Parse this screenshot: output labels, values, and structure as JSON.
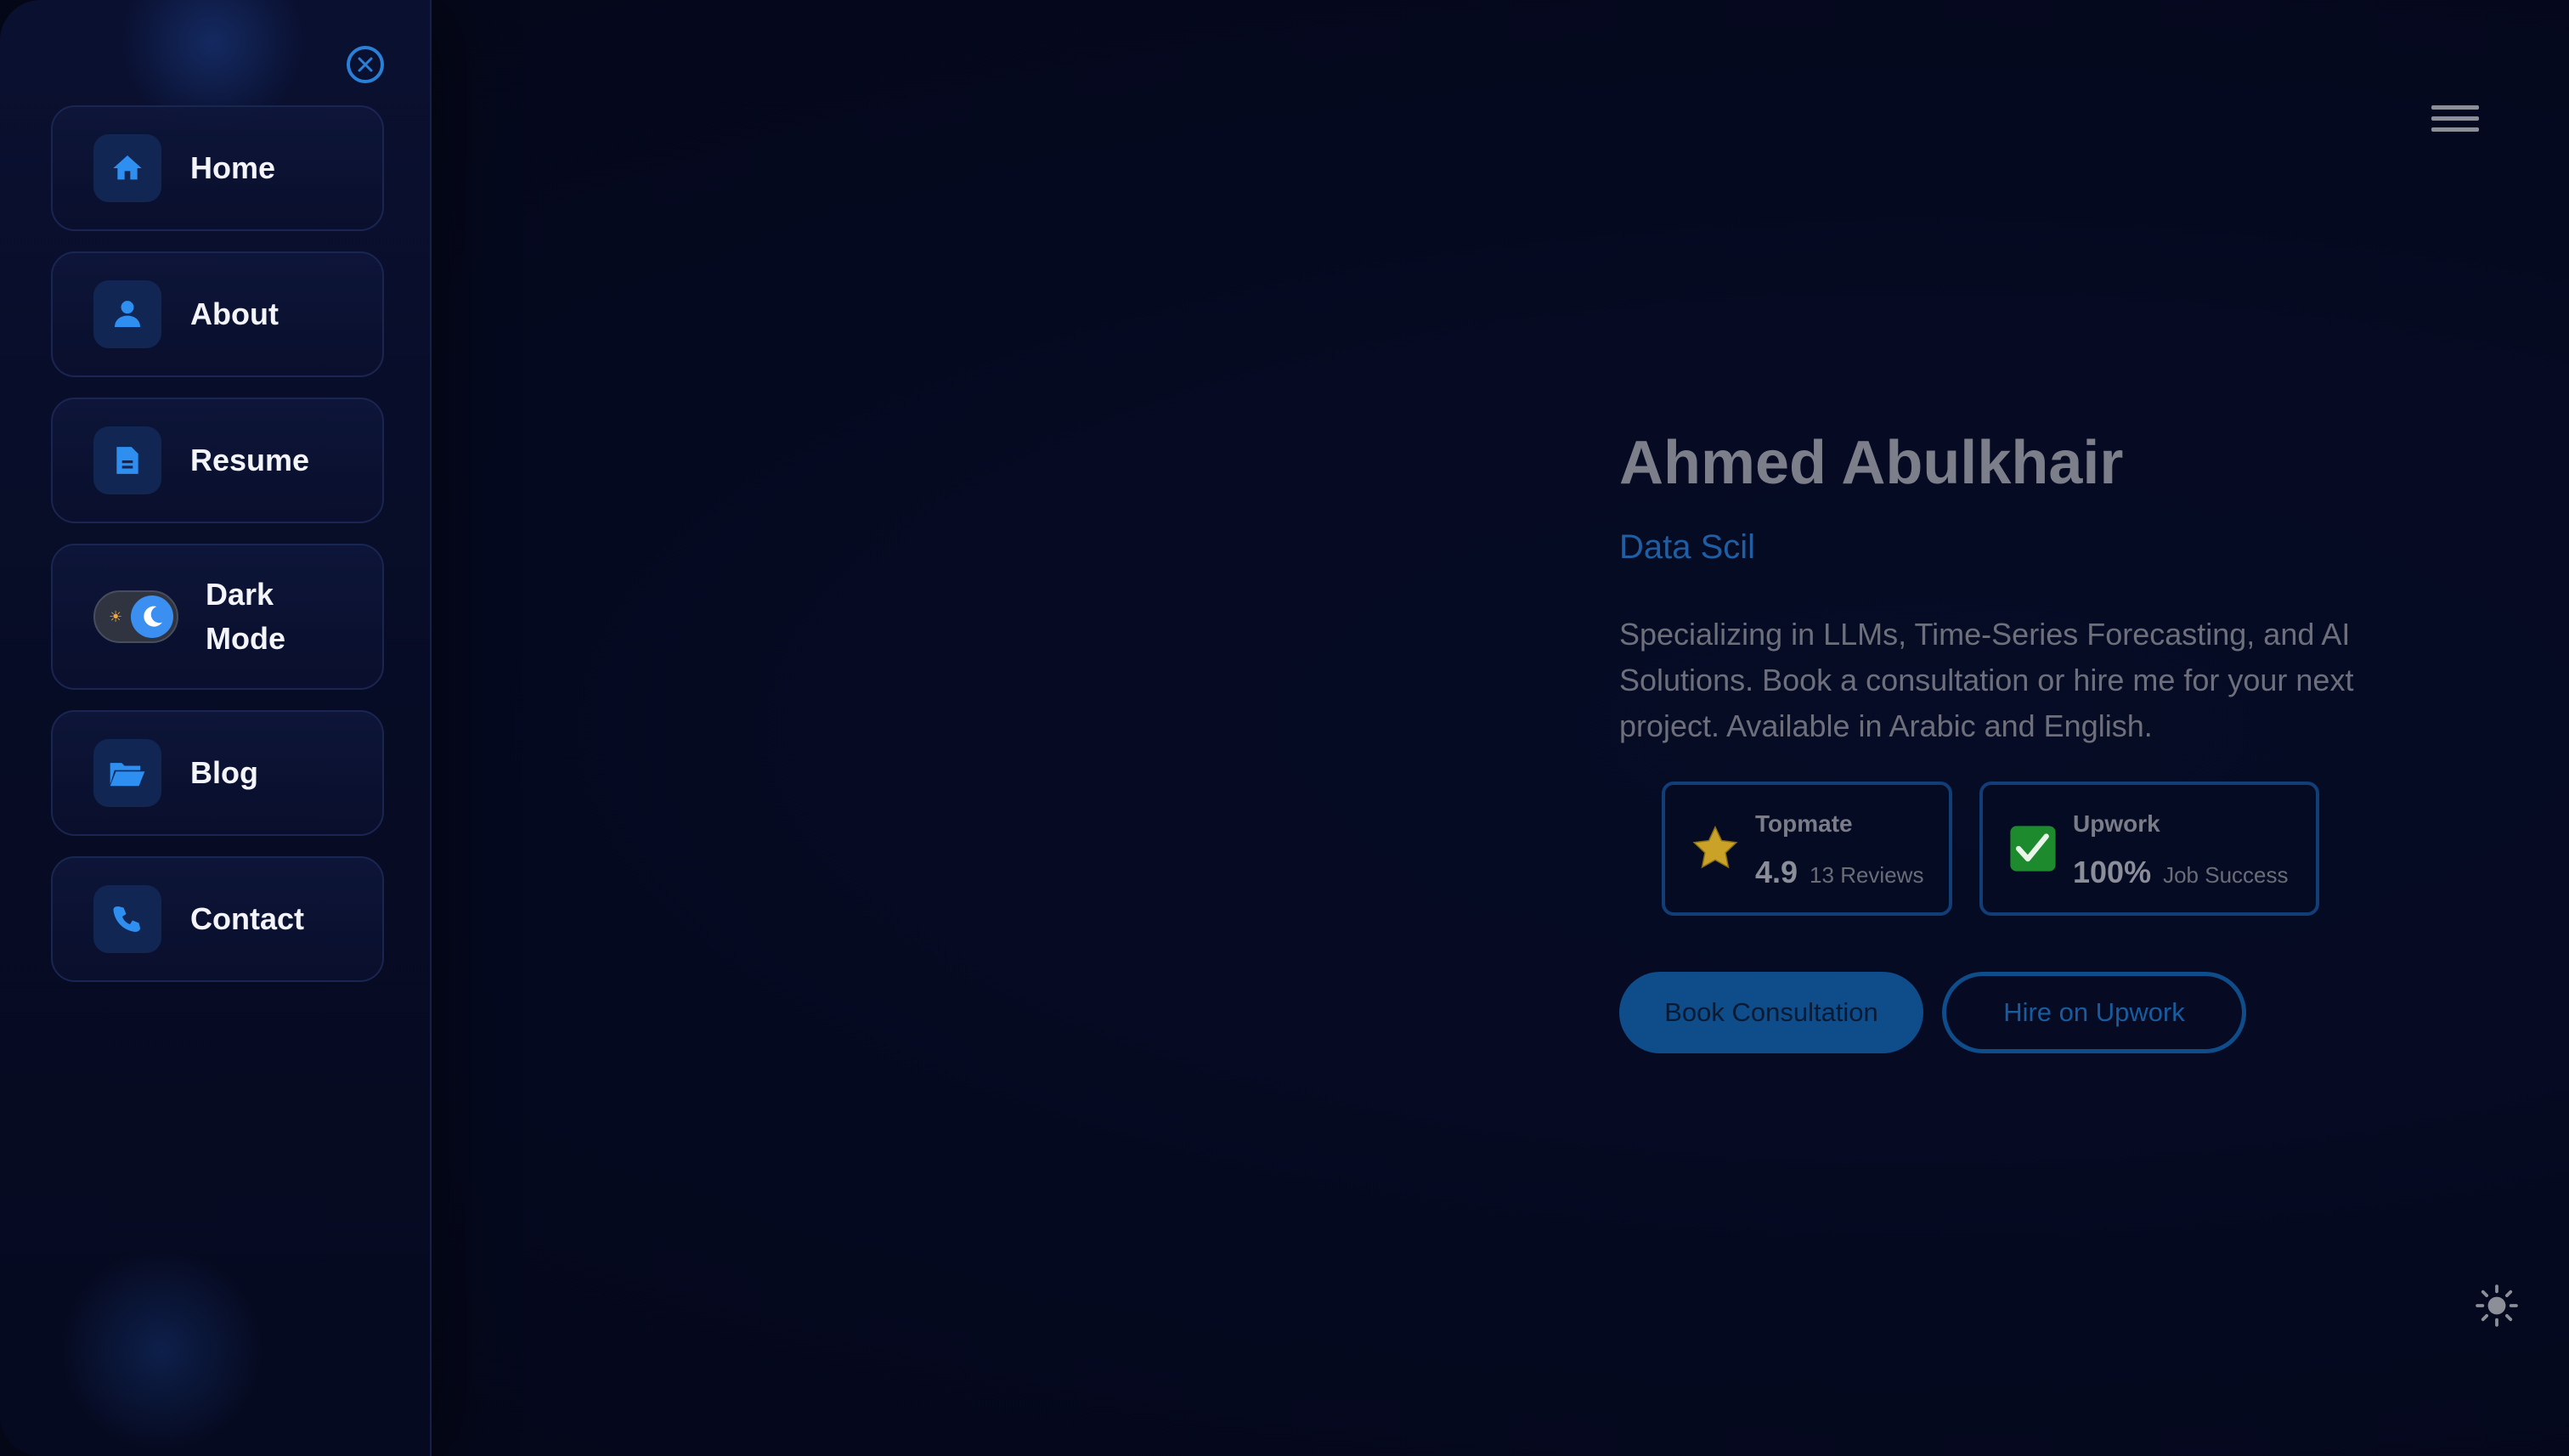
{
  "sidebar": {
    "close_icon": "close-icon",
    "items": [
      {
        "label": "Home",
        "icon": "home-icon"
      },
      {
        "label": "About",
        "icon": "user-icon"
      },
      {
        "label": "Resume",
        "icon": "document-icon"
      },
      {
        "label": "Dark Mode",
        "icon": "moon-icon",
        "toggle_on": true
      },
      {
        "label": "Blog",
        "icon": "folder-open-icon"
      },
      {
        "label": "Contact",
        "icon": "phone-icon"
      }
    ]
  },
  "header": {
    "menu_icon": "hamburger-menu-icon"
  },
  "hero": {
    "name": "Ahmed Abulkhair",
    "role": "Data Scil",
    "description": "Specializing in LLMs, Time-Series Forecasting, and AI Solutions. Book a consultation or hire me for your next project. Available in Arabic and English."
  },
  "stats": [
    {
      "title": "Topmate",
      "value": "4.9",
      "sub": "13 Reviews",
      "icon": "star-icon"
    },
    {
      "title": "Upwork",
      "value": "100%",
      "sub": "Job Success",
      "icon": "check-box-icon"
    }
  ],
  "buttons": {
    "primary": "Book Consultation",
    "secondary": "Hire on Upwork"
  },
  "theme_toggle_icon": "sun-icon",
  "colors": {
    "background": "#050920",
    "accent": "#2a7fd6",
    "button": "#0f4c8a",
    "star": "#c9a227",
    "check": "#1e8a2e"
  }
}
